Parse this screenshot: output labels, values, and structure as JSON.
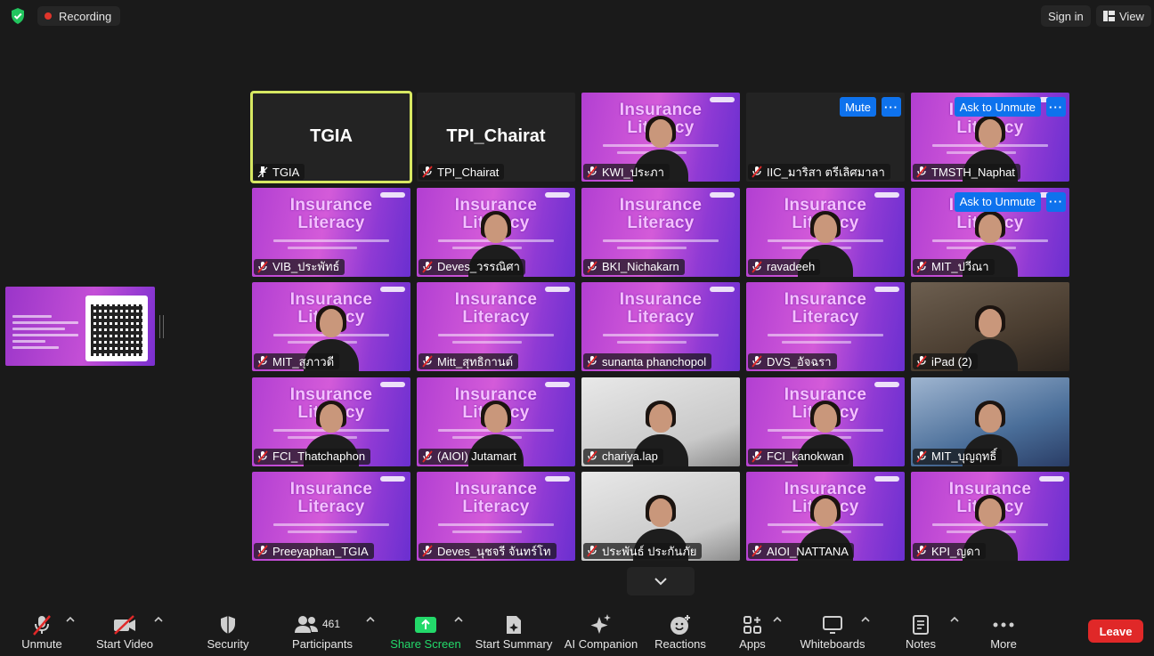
{
  "topbar": {
    "recording_label": "Recording",
    "sign_in_label": "Sign in",
    "view_label": "View"
  },
  "tiles": [
    {
      "name": "TGIA",
      "big": "TGIA",
      "kind": "blank",
      "active": true,
      "pinned": true
    },
    {
      "name": "TPI_Chairat",
      "big": "TPI_Chairat",
      "kind": "blank"
    },
    {
      "name": "KWI_ประภา",
      "kind": "slide",
      "person": true
    },
    {
      "name": "IIC_มาริสา ตรีเลิศมาลา",
      "kind": "black",
      "chips": [
        "Mute",
        "···"
      ]
    },
    {
      "name": "TMSTH_Naphat",
      "kind": "slide",
      "person": true,
      "chips": [
        "Ask to Unmute",
        "···"
      ]
    },
    {
      "name": "VIB_ประพัทธ์",
      "kind": "slide"
    },
    {
      "name": "Deves_วรรณิศา",
      "kind": "slide",
      "person": true
    },
    {
      "name": "BKI_Nichakarn",
      "kind": "slide"
    },
    {
      "name": "ravadeeh",
      "kind": "slide",
      "person": true
    },
    {
      "name": "MIT_ปวีณา",
      "kind": "slide",
      "person": true,
      "chips": [
        "Ask to Unmute",
        "···"
      ]
    },
    {
      "name": "MIT_สุภาวดี",
      "kind": "slide",
      "person": true
    },
    {
      "name": "Mitt_สุทธิกานต์",
      "kind": "slide"
    },
    {
      "name": "sunanta phanchopol",
      "kind": "slide"
    },
    {
      "name": "DVS_อัจฉรา",
      "kind": "slide"
    },
    {
      "name": "iPad (2)",
      "kind": "photo-dark",
      "person": true
    },
    {
      "name": "FCI_Thatchaphon",
      "kind": "slide",
      "person": true
    },
    {
      "name": "(AIOI) Jutamart",
      "kind": "slide",
      "person": true
    },
    {
      "name": "chariya.lap",
      "kind": "photo-white",
      "person": true
    },
    {
      "name": "FCI_kanokwan",
      "kind": "slide",
      "person": true
    },
    {
      "name": "MIT_บุญฤทธิ์",
      "kind": "photo-blue",
      "person": true
    },
    {
      "name": "Preeyaphan_TGIA",
      "kind": "slide"
    },
    {
      "name": "Deves_นุชจรี จันทร์โท",
      "kind": "slide"
    },
    {
      "name": "ประพันธ์ ประกันภัย",
      "kind": "photo-white",
      "person": true
    },
    {
      "name": "AIOI_NATTANA",
      "kind": "slide",
      "person": true
    },
    {
      "name": "KPI_ญดา",
      "kind": "slide",
      "person": true
    }
  ],
  "slide": {
    "line1": "Insurance",
    "line2": "Literacy"
  },
  "toolbar": {
    "unmute": "Unmute",
    "start_video": "Start Video",
    "security": "Security",
    "participants": "Participants",
    "participant_count": "461",
    "share_screen": "Share Screen",
    "start_summary": "Start Summary",
    "ai_companion": "AI Companion",
    "reactions": "Reactions",
    "apps": "Apps",
    "whiteboards": "Whiteboards",
    "notes": "Notes",
    "more": "More",
    "leave": "Leave"
  },
  "colors": {
    "accent_blue": "#0e72ed",
    "leave_red": "#e02828",
    "share_green": "#23d96a",
    "active_speaker": "#d7e862"
  }
}
